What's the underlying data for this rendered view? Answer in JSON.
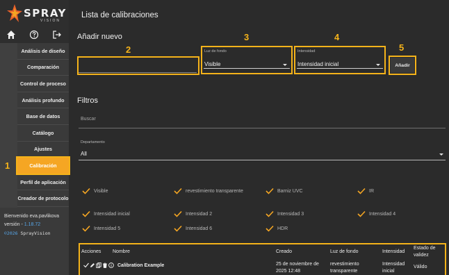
{
  "app": {
    "logo_main": "SPRAY",
    "logo_sub": "VISION",
    "brand_color": "#f5a623"
  },
  "sidebar": {
    "icons": [
      "home-icon",
      "help-icon",
      "logout-icon"
    ],
    "items": [
      {
        "label": "Análisis de diseño"
      },
      {
        "label": "Comparación"
      },
      {
        "label": "Control de proceso"
      },
      {
        "label": "Análisis profundo"
      },
      {
        "label": "Base de datos"
      },
      {
        "label": "Catálogo"
      },
      {
        "label": "Ajustes"
      },
      {
        "label": "Calibración"
      },
      {
        "label": "Perfil de aplicación"
      },
      {
        "label": "Creador de protocolo"
      }
    ],
    "active_item": "Calibración",
    "welcome": "Bienvenido eva.pavlikova",
    "version_label": "versión - ",
    "version": "1.18.72",
    "copyright_year": "©2026",
    "copyright_name": " SprayVision"
  },
  "annotations": [
    "1",
    "2",
    "3",
    "4",
    "5"
  ],
  "main": {
    "title": "Lista de calibraciones",
    "add_section": {
      "title": "Añadir nuevo",
      "name_value": "",
      "background": {
        "label": "Luz de fondo",
        "value": "Visible"
      },
      "intensity": {
        "label": "Intensidad",
        "value": "Intensidad inicial"
      },
      "add_button": "Añadir"
    },
    "filters": {
      "title": "Filtros",
      "search_placeholder": "Buscar",
      "department": {
        "label": "Departamento",
        "value": "All"
      },
      "checks": [
        "Visible",
        "revestimiento transparente",
        "Barniz UVC",
        "IR",
        "Intensidad inicial",
        "Intensidad 2",
        "Intensidad 3",
        "Intensidad 4",
        "Intensidad 5",
        "Intensidad 6",
        "HDR"
      ]
    },
    "table": {
      "headers": {
        "actions": "Acciones",
        "name": "Nombre",
        "created": "Creado",
        "background": "Luz de fondo",
        "intensity": "Intensidad",
        "validity_1": "Estado de",
        "validity_2": "validez"
      },
      "rows": [
        {
          "name": "Calibration Example",
          "created_1": "25 de noviembre de",
          "created_2": "2025 12:48",
          "background_1": "revestimiento",
          "background_2": "transparente",
          "intensity_1": "Intensidad",
          "intensity_2": "inicial",
          "validity": "Válido"
        }
      ]
    }
  }
}
